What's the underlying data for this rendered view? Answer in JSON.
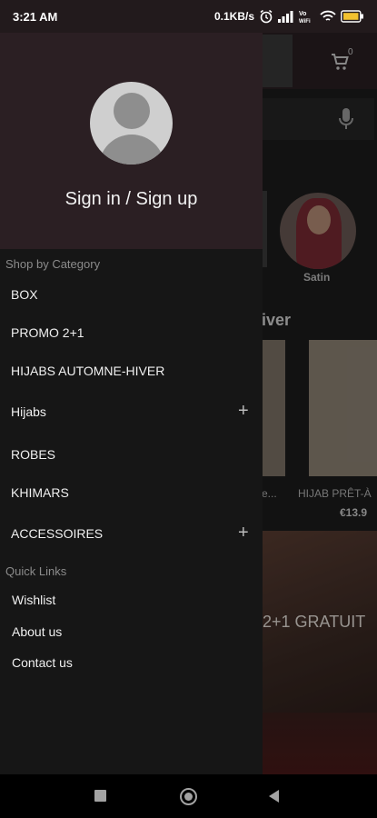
{
  "status_bar": {
    "time": "3:21 AM",
    "speed": "0.1KB/s",
    "icons": [
      "alarm-icon",
      "signal-icon",
      "vowifi-icon",
      "wifi-icon",
      "battery-icon"
    ],
    "vowifi_text": "Vo WiFi"
  },
  "drawer": {
    "signin_label": "Sign in / Sign up",
    "shop_section_label": "Shop by Category",
    "categories": [
      {
        "label": "BOX",
        "expandable": false
      },
      {
        "label": "PROMO 2+1",
        "expandable": false
      },
      {
        "label": "HIJABS AUTOMNE-HIVER",
        "expandable": false
      },
      {
        "label": "Hijabs",
        "expandable": true
      },
      {
        "label": "ROBES",
        "expandable": false
      },
      {
        "label": "KHIMARS",
        "expandable": false
      },
      {
        "label": "ACCESSOIRES",
        "expandable": true
      }
    ],
    "expand_symbol": "+",
    "quick_section_label": "Quick Links",
    "quick_links": [
      {
        "label": "Wishlist"
      },
      {
        "label": "About us"
      },
      {
        "label": "Contact us"
      }
    ]
  },
  "background": {
    "cart_count": "0",
    "category_label": "Satin",
    "section_title_fragment": "iver",
    "product_a_name_fragment": "e...",
    "product_b_name": "HIJAB PRÊT-À",
    "product_b_price": "€13.9",
    "banner_text": "2+1 GRATUIT"
  },
  "colors": {
    "drawer_header": "#2b1f23",
    "drawer_body": "#161616",
    "section_label": "#8b8b8b"
  }
}
